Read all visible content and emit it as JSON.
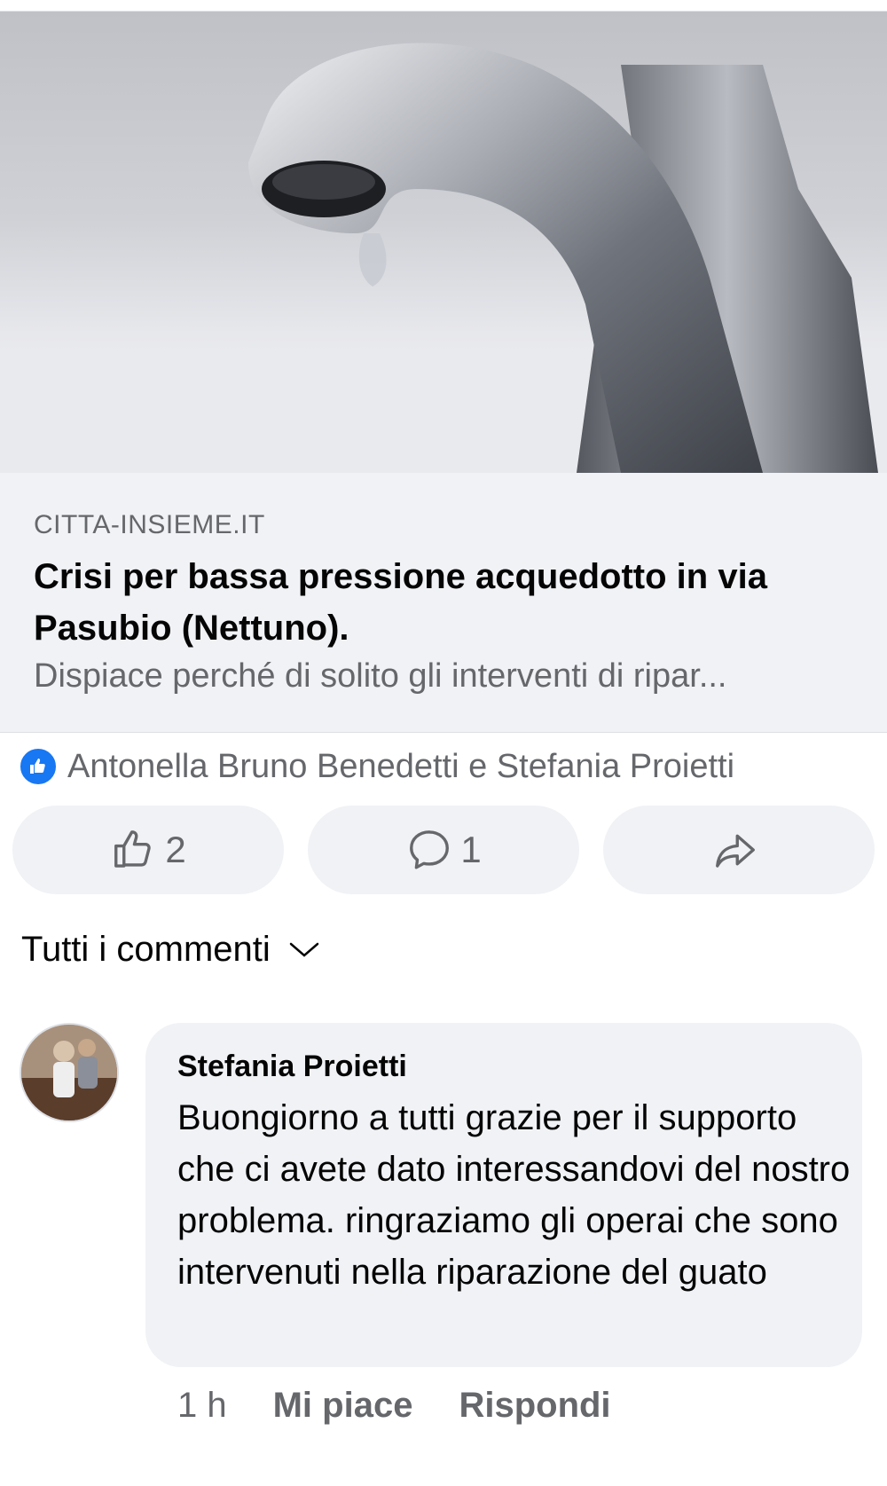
{
  "link": {
    "domain": "CITTA-INSIEME.IT",
    "title": "Crisi per bassa pressione acquedotto in via Pasubio (Nettuno).",
    "description": "Dispiace perché di solito gli interventi di ripar..."
  },
  "reactions": {
    "names": "Antonella Bruno Benedetti e Stefania Proietti"
  },
  "actions": {
    "like_count": "2",
    "comment_count": "1"
  },
  "comments_filter": {
    "label": "Tutti i commenti"
  },
  "comment": {
    "author": "Stefania Proietti",
    "text": "Buongiorno a tutti grazie per il supporto che ci avete dato interessandovi del nostro problema. ringraziamo gli operai che sono intervenuti nella riparazione del guato",
    "time": "1 h",
    "like_label": "Mi piace",
    "reply_label": "Rispondi"
  },
  "colors": {
    "accent": "#1877f2",
    "secondary_text": "#65676b",
    "surface": "#f0f2f5"
  },
  "icons": [
    "like-badge-icon",
    "thumbs-up-icon",
    "comment-icon",
    "share-icon",
    "chevron-down-icon"
  ]
}
